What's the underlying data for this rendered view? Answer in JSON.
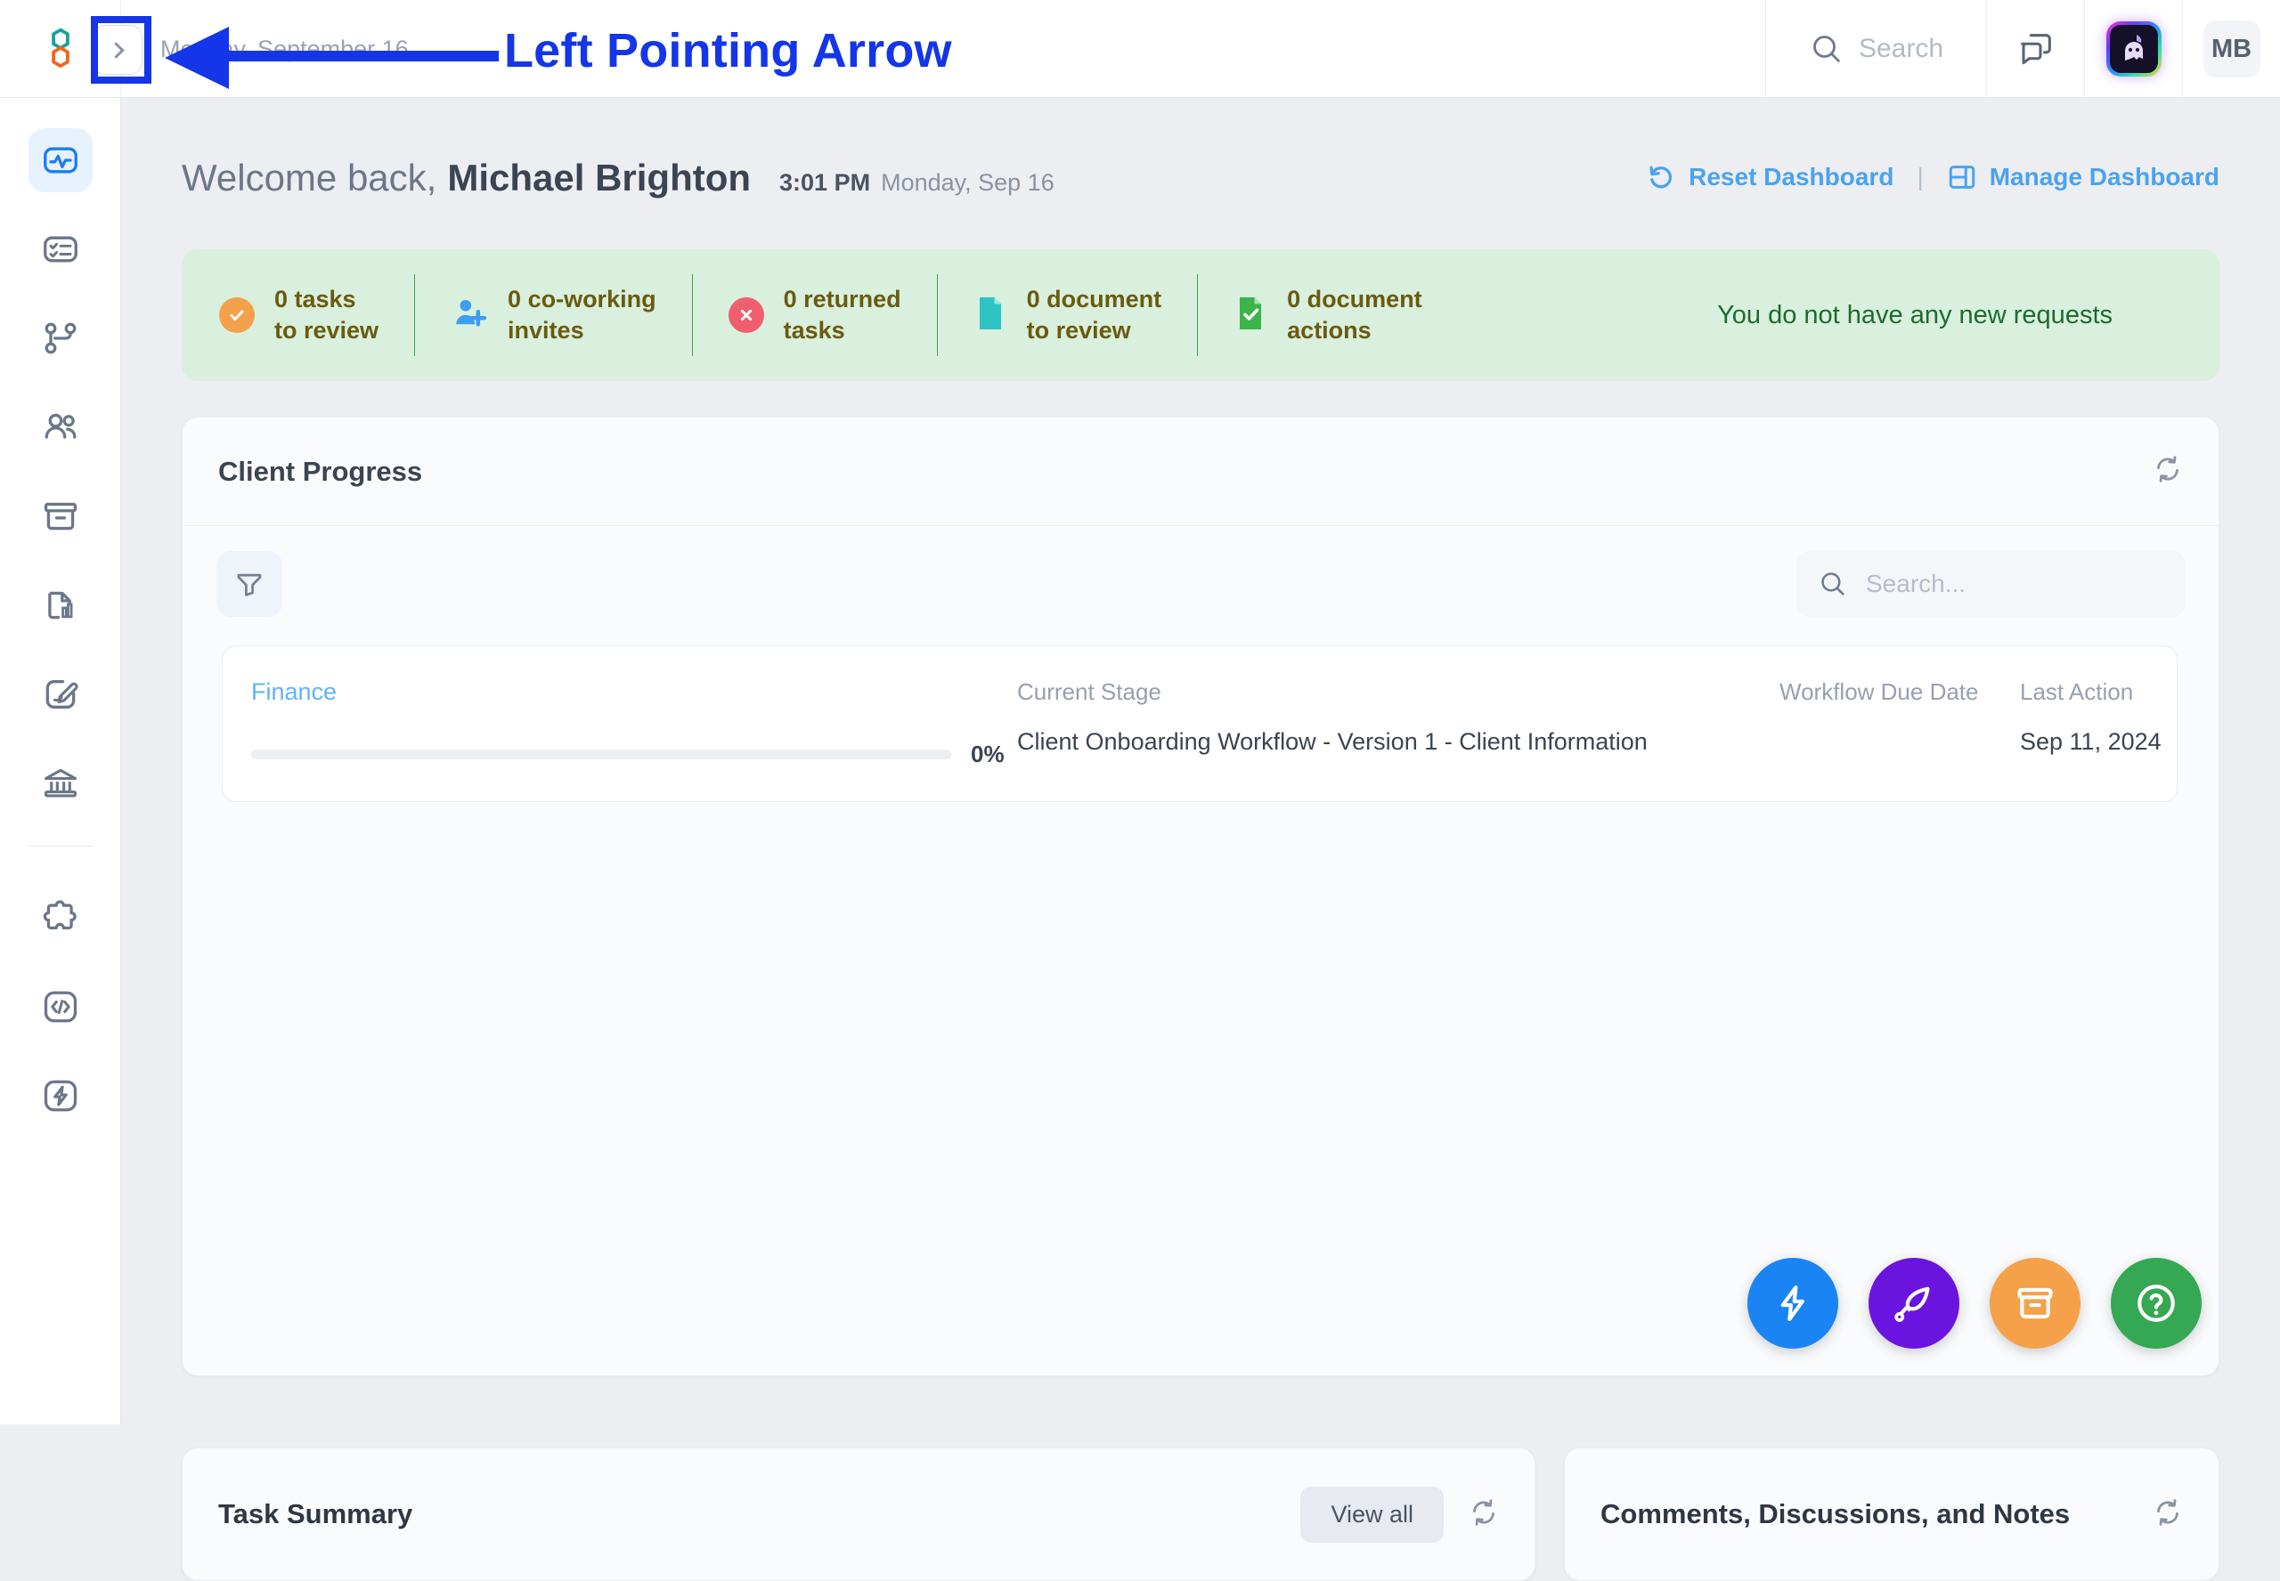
{
  "topbar": {
    "logo_name": "app-logo",
    "collapse_button": "expand-sidebar",
    "date_behind": "Monday, September 16",
    "search_label": "Search",
    "chat_icon": "chat-bubbles-icon",
    "ai_icon": "ai-assistant-avatar",
    "user_initials": "MB"
  },
  "sidebar": {
    "items": [
      {
        "name": "dashboard",
        "icon": "activity-pulse-icon",
        "active": true
      },
      {
        "name": "tasks",
        "icon": "checklist-icon",
        "active": false
      },
      {
        "name": "workflows",
        "icon": "workflow-branch-icon",
        "active": false
      },
      {
        "name": "clients",
        "icon": "people-icon",
        "active": false
      },
      {
        "name": "archive",
        "icon": "archive-box-icon",
        "active": false
      },
      {
        "name": "reports",
        "icon": "document-chart-icon",
        "active": false
      },
      {
        "name": "signatures",
        "icon": "edit-pen-icon",
        "active": false
      },
      {
        "name": "accounts",
        "icon": "bank-icon",
        "active": false
      },
      {
        "name": "integrations",
        "icon": "puzzle-piece-icon",
        "active": false
      },
      {
        "name": "developer",
        "icon": "code-brackets-icon",
        "active": false
      },
      {
        "name": "automation",
        "icon": "lightning-bolt-icon",
        "active": false
      }
    ]
  },
  "welcome": {
    "greeting": "Welcome back,",
    "user_name": "Michael Brighton",
    "time": "3:01 PM",
    "date": "Monday, Sep 16",
    "reset_label": "Reset Dashboard",
    "separator": "|",
    "manage_label": "Manage Dashboard"
  },
  "notifications": {
    "items": [
      {
        "count": "0 tasks",
        "label": "to review",
        "icon": "circle-check-icon",
        "color": "#f5a04a"
      },
      {
        "count": "0 co-working",
        "label": "invites",
        "icon": "person-add-icon",
        "color": "#3d9df0"
      },
      {
        "count": "0 returned",
        "label": "tasks",
        "icon": "circle-x-icon",
        "color": "#ef5f6e"
      },
      {
        "count": "0 document",
        "label": "to review",
        "icon": "document-icon",
        "color": "#2ec4c4"
      },
      {
        "count": "0 document",
        "label": "actions",
        "icon": "document-check-icon",
        "color": "#3cb44a"
      }
    ],
    "message": "You do not have any new requests",
    "bg_color": "#d8f0dd",
    "text_color": "#6b5a10",
    "message_color": "#1d6b2e"
  },
  "client_progress": {
    "title": "Client Progress",
    "refresh_icon": "refresh-icon",
    "filter_icon": "filter-funnel-icon",
    "search_placeholder": "Search...",
    "columns": {
      "name": "",
      "stage": "Current Stage",
      "due": "Workflow Due Date",
      "last": "Last Action"
    },
    "rows": [
      {
        "client": "Finance",
        "progress_pct": "0%",
        "progress_value": 0,
        "stage": "Client Onboarding Workflow - Version 1 - Client Information",
        "due_date": "",
        "last_action": "Sep 11, 2024"
      }
    ]
  },
  "task_summary": {
    "title": "Task Summary",
    "view_all": "View all",
    "refresh_icon": "refresh-icon"
  },
  "comments_panel": {
    "title": "Comments, Discussions, and Notes",
    "refresh_icon": "refresh-icon"
  },
  "fabs": [
    {
      "name": "quick-actions",
      "icon": "lightning-bolt-icon",
      "color": "#1a84f5"
    },
    {
      "name": "whats-new",
      "icon": "rocket-icon",
      "color": "#6b14e0"
    },
    {
      "name": "archive-fab",
      "icon": "archive-box-icon",
      "color": "#f5a14a"
    },
    {
      "name": "help",
      "icon": "question-circle-icon",
      "color": "#34a853"
    }
  ],
  "annotation": {
    "label": "Left Pointing Arrow",
    "color": "#1436e8"
  }
}
